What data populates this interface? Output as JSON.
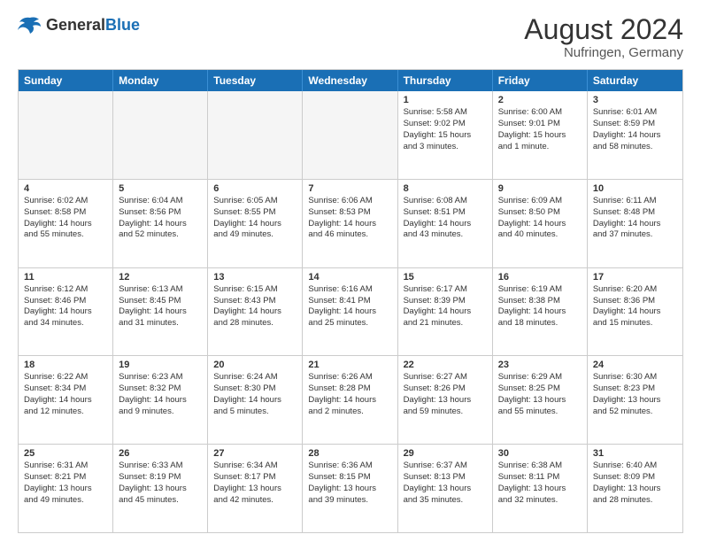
{
  "header": {
    "logo_general": "General",
    "logo_blue": "Blue",
    "month_year": "August 2024",
    "location": "Nufringen, Germany"
  },
  "days_of_week": [
    "Sunday",
    "Monday",
    "Tuesday",
    "Wednesday",
    "Thursday",
    "Friday",
    "Saturday"
  ],
  "weeks": [
    [
      {
        "day": "",
        "content": "",
        "empty": true
      },
      {
        "day": "",
        "content": "",
        "empty": true
      },
      {
        "day": "",
        "content": "",
        "empty": true
      },
      {
        "day": "",
        "content": "",
        "empty": true
      },
      {
        "day": "1",
        "content": "Sunrise: 5:58 AM\nSunset: 9:02 PM\nDaylight: 15 hours\nand 3 minutes.",
        "empty": false
      },
      {
        "day": "2",
        "content": "Sunrise: 6:00 AM\nSunset: 9:01 PM\nDaylight: 15 hours\nand 1 minute.",
        "empty": false
      },
      {
        "day": "3",
        "content": "Sunrise: 6:01 AM\nSunset: 8:59 PM\nDaylight: 14 hours\nand 58 minutes.",
        "empty": false
      }
    ],
    [
      {
        "day": "4",
        "content": "Sunrise: 6:02 AM\nSunset: 8:58 PM\nDaylight: 14 hours\nand 55 minutes.",
        "empty": false
      },
      {
        "day": "5",
        "content": "Sunrise: 6:04 AM\nSunset: 8:56 PM\nDaylight: 14 hours\nand 52 minutes.",
        "empty": false
      },
      {
        "day": "6",
        "content": "Sunrise: 6:05 AM\nSunset: 8:55 PM\nDaylight: 14 hours\nand 49 minutes.",
        "empty": false
      },
      {
        "day": "7",
        "content": "Sunrise: 6:06 AM\nSunset: 8:53 PM\nDaylight: 14 hours\nand 46 minutes.",
        "empty": false
      },
      {
        "day": "8",
        "content": "Sunrise: 6:08 AM\nSunset: 8:51 PM\nDaylight: 14 hours\nand 43 minutes.",
        "empty": false
      },
      {
        "day": "9",
        "content": "Sunrise: 6:09 AM\nSunset: 8:50 PM\nDaylight: 14 hours\nand 40 minutes.",
        "empty": false
      },
      {
        "day": "10",
        "content": "Sunrise: 6:11 AM\nSunset: 8:48 PM\nDaylight: 14 hours\nand 37 minutes.",
        "empty": false
      }
    ],
    [
      {
        "day": "11",
        "content": "Sunrise: 6:12 AM\nSunset: 8:46 PM\nDaylight: 14 hours\nand 34 minutes.",
        "empty": false
      },
      {
        "day": "12",
        "content": "Sunrise: 6:13 AM\nSunset: 8:45 PM\nDaylight: 14 hours\nand 31 minutes.",
        "empty": false
      },
      {
        "day": "13",
        "content": "Sunrise: 6:15 AM\nSunset: 8:43 PM\nDaylight: 14 hours\nand 28 minutes.",
        "empty": false
      },
      {
        "day": "14",
        "content": "Sunrise: 6:16 AM\nSunset: 8:41 PM\nDaylight: 14 hours\nand 25 minutes.",
        "empty": false
      },
      {
        "day": "15",
        "content": "Sunrise: 6:17 AM\nSunset: 8:39 PM\nDaylight: 14 hours\nand 21 minutes.",
        "empty": false
      },
      {
        "day": "16",
        "content": "Sunrise: 6:19 AM\nSunset: 8:38 PM\nDaylight: 14 hours\nand 18 minutes.",
        "empty": false
      },
      {
        "day": "17",
        "content": "Sunrise: 6:20 AM\nSunset: 8:36 PM\nDaylight: 14 hours\nand 15 minutes.",
        "empty": false
      }
    ],
    [
      {
        "day": "18",
        "content": "Sunrise: 6:22 AM\nSunset: 8:34 PM\nDaylight: 14 hours\nand 12 minutes.",
        "empty": false
      },
      {
        "day": "19",
        "content": "Sunrise: 6:23 AM\nSunset: 8:32 PM\nDaylight: 14 hours\nand 9 minutes.",
        "empty": false
      },
      {
        "day": "20",
        "content": "Sunrise: 6:24 AM\nSunset: 8:30 PM\nDaylight: 14 hours\nand 5 minutes.",
        "empty": false
      },
      {
        "day": "21",
        "content": "Sunrise: 6:26 AM\nSunset: 8:28 PM\nDaylight: 14 hours\nand 2 minutes.",
        "empty": false
      },
      {
        "day": "22",
        "content": "Sunrise: 6:27 AM\nSunset: 8:26 PM\nDaylight: 13 hours\nand 59 minutes.",
        "empty": false
      },
      {
        "day": "23",
        "content": "Sunrise: 6:29 AM\nSunset: 8:25 PM\nDaylight: 13 hours\nand 55 minutes.",
        "empty": false
      },
      {
        "day": "24",
        "content": "Sunrise: 6:30 AM\nSunset: 8:23 PM\nDaylight: 13 hours\nand 52 minutes.",
        "empty": false
      }
    ],
    [
      {
        "day": "25",
        "content": "Sunrise: 6:31 AM\nSunset: 8:21 PM\nDaylight: 13 hours\nand 49 minutes.",
        "empty": false
      },
      {
        "day": "26",
        "content": "Sunrise: 6:33 AM\nSunset: 8:19 PM\nDaylight: 13 hours\nand 45 minutes.",
        "empty": false
      },
      {
        "day": "27",
        "content": "Sunrise: 6:34 AM\nSunset: 8:17 PM\nDaylight: 13 hours\nand 42 minutes.",
        "empty": false
      },
      {
        "day": "28",
        "content": "Sunrise: 6:36 AM\nSunset: 8:15 PM\nDaylight: 13 hours\nand 39 minutes.",
        "empty": false
      },
      {
        "day": "29",
        "content": "Sunrise: 6:37 AM\nSunset: 8:13 PM\nDaylight: 13 hours\nand 35 minutes.",
        "empty": false
      },
      {
        "day": "30",
        "content": "Sunrise: 6:38 AM\nSunset: 8:11 PM\nDaylight: 13 hours\nand 32 minutes.",
        "empty": false
      },
      {
        "day": "31",
        "content": "Sunrise: 6:40 AM\nSunset: 8:09 PM\nDaylight: 13 hours\nand 28 minutes.",
        "empty": false
      }
    ]
  ]
}
